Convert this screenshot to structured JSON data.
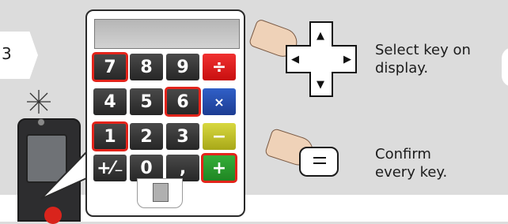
{
  "step": {
    "number": "3"
  },
  "calculator": {
    "keys": [
      {
        "label": "7",
        "color": "dark",
        "highlighted": true
      },
      {
        "label": "8",
        "color": "dark",
        "highlighted": false
      },
      {
        "label": "9",
        "color": "dark",
        "highlighted": false
      },
      {
        "label": "÷",
        "color": "red",
        "highlighted": false
      },
      {
        "label": "4",
        "color": "dark",
        "highlighted": false
      },
      {
        "label": "5",
        "color": "dark",
        "highlighted": false
      },
      {
        "label": "6",
        "color": "dark",
        "highlighted": true
      },
      {
        "label": "×",
        "color": "blue",
        "highlighted": false
      },
      {
        "label": "1",
        "color": "dark",
        "highlighted": true
      },
      {
        "label": "2",
        "color": "dark",
        "highlighted": false
      },
      {
        "label": "3",
        "color": "dark",
        "highlighted": false
      },
      {
        "label": "−",
        "color": "yellow",
        "highlighted": false
      },
      {
        "label": "+⁄₋",
        "color": "dark",
        "highlighted": false
      },
      {
        "label": "0",
        "color": "dark",
        "highlighted": false
      },
      {
        "label": ",",
        "color": "dark",
        "highlighted": false
      },
      {
        "label": "+",
        "color": "green",
        "highlighted": true
      }
    ]
  },
  "instructions": {
    "select": {
      "line1": "Select key on",
      "line2": "display."
    },
    "confirm": {
      "line1": "Confirm",
      "line2": "every key."
    }
  },
  "colors": {
    "highlight": "#e3241b",
    "divide": "#e52a22",
    "multiply": "#2b56b9",
    "minus": "#cfcf2e",
    "plus": "#2da22f"
  }
}
